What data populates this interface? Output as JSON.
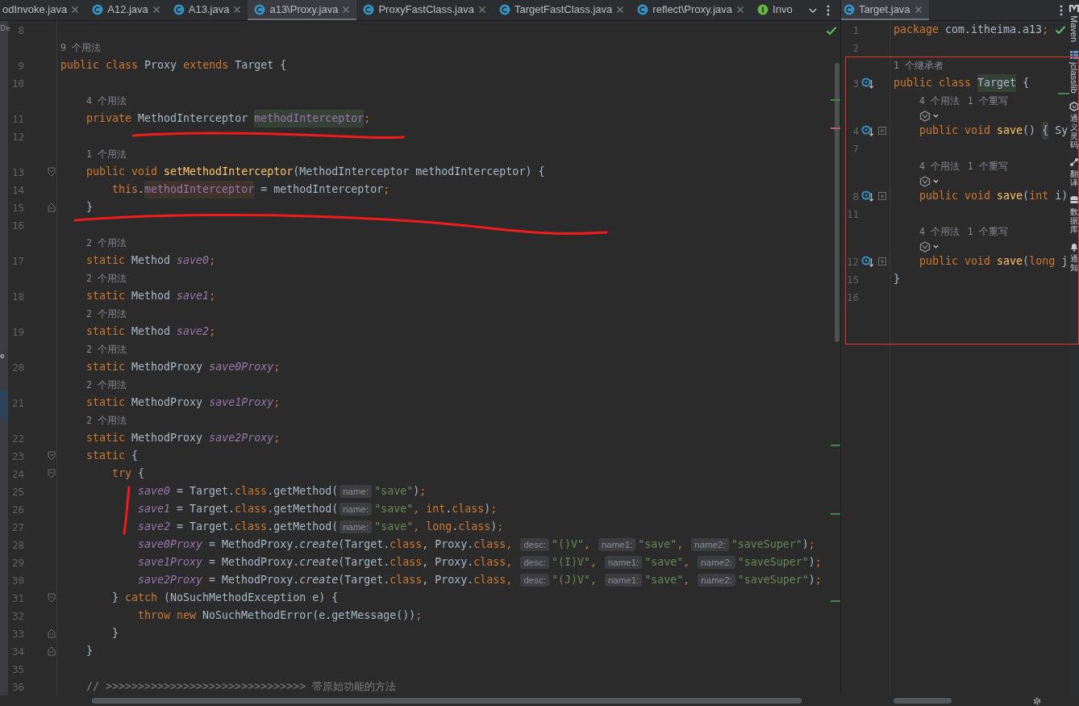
{
  "left_editor": {
    "tabs": [
      {
        "label": "odInvoke.java",
        "kind": "file",
        "closable": true,
        "selected": false
      },
      {
        "label": "A12.java",
        "kind": "class",
        "closable": true,
        "selected": false
      },
      {
        "label": "A13.java",
        "kind": "class",
        "closable": true,
        "selected": false
      },
      {
        "label": "a13\\Proxy.java",
        "kind": "class",
        "closable": true,
        "selected": true
      },
      {
        "label": "ProxyFastClass.java",
        "kind": "class",
        "closable": true,
        "selected": false
      },
      {
        "label": "TargetFastClass.java",
        "kind": "class",
        "closable": true,
        "selected": false
      },
      {
        "label": "reflect\\Proxy.java",
        "kind": "class",
        "closable": true,
        "selected": false
      },
      {
        "label": "Invo",
        "kind": "interface",
        "closable": false,
        "selected": false
      }
    ],
    "lines": [
      {
        "kind": "code",
        "number": "8"
      },
      {
        "kind": "hint",
        "texts": [
          "9 个用法"
        ]
      },
      {
        "kind": "code",
        "number": "9",
        "tokens": [
          {
            "kind": "kw",
            "text": "public class "
          },
          {
            "kind": "plain",
            "text": "Proxy "
          },
          {
            "kind": "kw",
            "text": "extends "
          },
          {
            "kind": "plain",
            "text": "Target {"
          }
        ],
        "children": [
          {
            "kind": "code",
            "number": "10"
          },
          {
            "kind": "hint",
            "texts": [
              "4 个用法"
            ]
          },
          {
            "kind": "code",
            "number": "11",
            "tokens": [
              {
                "kind": "kw",
                "text": "private "
              },
              {
                "kind": "plain",
                "text": "MethodInterceptor "
              },
              {
                "kind": "field",
                "text": "methodInterceptor",
                "write_access": true
              },
              {
                "kind": "kw",
                "text": ";"
              }
            ]
          },
          {
            "kind": "code",
            "number": "12"
          },
          {
            "kind": "hint",
            "texts": [
              "1 个用法"
            ]
          },
          {
            "kind": "code",
            "number": "13",
            "fold_open": true,
            "tokens": [
              {
                "kind": "kw",
                "text": "public void "
              },
              {
                "kind": "decl",
                "text": "setMethodInterceptor"
              },
              {
                "kind": "plain",
                "text": "(MethodInterceptor methodInterceptor) {"
              }
            ],
            "children": [
              {
                "kind": "code",
                "number": "14",
                "tokens": [
                  {
                    "kind": "kw",
                    "text": "this"
                  },
                  {
                    "kind": "plain",
                    "text": "."
                  },
                  {
                    "kind": "field",
                    "text": "methodInterceptor",
                    "read_access": true
                  },
                  {
                    "kind": "plain",
                    "text": " = methodInterceptor"
                  },
                  {
                    "kind": "kw",
                    "text": ";"
                  }
                ]
              }
            ]
          },
          {
            "kind": "code",
            "number": "15",
            "fold_close": true,
            "tokens": [
              {
                "kind": "plain",
                "text": "}"
              }
            ]
          },
          {
            "kind": "code",
            "number": "16"
          },
          {
            "kind": "hint",
            "texts": [
              "2 个用法"
            ]
          },
          {
            "kind": "code",
            "number": "17",
            "tokens": [
              {
                "kind": "kw",
                "text": "static "
              },
              {
                "kind": "plain",
                "text": "Method "
              },
              {
                "kind": "sfield",
                "text": "save0"
              },
              {
                "kind": "kw",
                "text": ";"
              }
            ]
          },
          {
            "kind": "hint",
            "texts": [
              "2 个用法"
            ]
          },
          {
            "kind": "code",
            "number": "18",
            "tokens": [
              {
                "kind": "kw",
                "text": "static "
              },
              {
                "kind": "plain",
                "text": "Method "
              },
              {
                "kind": "sfield",
                "text": "save1"
              },
              {
                "kind": "kw",
                "text": ";"
              }
            ]
          },
          {
            "kind": "hint",
            "texts": [
              "2 个用法"
            ]
          },
          {
            "kind": "code",
            "number": "19",
            "tokens": [
              {
                "kind": "kw",
                "text": "static "
              },
              {
                "kind": "plain",
                "text": "Method "
              },
              {
                "kind": "sfield",
                "text": "save2"
              },
              {
                "kind": "kw",
                "text": ";"
              }
            ]
          },
          {
            "kind": "hint",
            "texts": [
              "2 个用法"
            ]
          },
          {
            "kind": "code",
            "number": "20",
            "tokens": [
              {
                "kind": "kw",
                "text": "static "
              },
              {
                "kind": "plain",
                "text": "MethodProxy "
              },
              {
                "kind": "sfield",
                "text": "save0Proxy"
              },
              {
                "kind": "kw",
                "text": ";"
              }
            ]
          },
          {
            "kind": "hint",
            "texts": [
              "2 个用法"
            ]
          },
          {
            "kind": "code",
            "number": "21",
            "tokens": [
              {
                "kind": "kw",
                "text": "static "
              },
              {
                "kind": "plain",
                "text": "MethodProxy "
              },
              {
                "kind": "sfield",
                "text": "save1Proxy"
              },
              {
                "kind": "kw",
                "text": ";"
              }
            ]
          },
          {
            "kind": "hint",
            "texts": [
              "2 个用法"
            ]
          },
          {
            "kind": "code",
            "number": "22",
            "tokens": [
              {
                "kind": "kw",
                "text": "static "
              },
              {
                "kind": "plain",
                "text": "MethodProxy "
              },
              {
                "kind": "sfield",
                "text": "save2Proxy"
              },
              {
                "kind": "kw",
                "text": ";"
              }
            ]
          },
          {
            "kind": "code",
            "number": "23",
            "fold_open": true,
            "tokens": [
              {
                "kind": "kw",
                "text": "static "
              },
              {
                "kind": "plain",
                "text": "{"
              }
            ],
            "children": [
              {
                "kind": "code",
                "number": "24",
                "fold_open": true,
                "tokens": [
                  {
                    "kind": "kw",
                    "text": "try "
                  },
                  {
                    "kind": "plain",
                    "text": "{"
                  }
                ],
                "children": [
                  {
                    "kind": "code",
                    "number": "25",
                    "tokens": [
                      {
                        "kind": "sfield",
                        "text": "save0"
                      },
                      {
                        "kind": "plain",
                        "text": " = Target."
                      },
                      {
                        "kind": "kw",
                        "text": "class"
                      },
                      {
                        "kind": "plain",
                        "text": ".getMethod("
                      },
                      {
                        "kind": "hint",
                        "text": "name:"
                      },
                      {
                        "kind": "str",
                        "text": "\"save\""
                      },
                      {
                        "kind": "plain",
                        "text": ")"
                      },
                      {
                        "kind": "kw",
                        "text": ";"
                      }
                    ]
                  },
                  {
                    "kind": "code",
                    "number": "26",
                    "tokens": [
                      {
                        "kind": "sfield",
                        "text": "save1"
                      },
                      {
                        "kind": "plain",
                        "text": " = Target."
                      },
                      {
                        "kind": "kw",
                        "text": "class"
                      },
                      {
                        "kind": "plain",
                        "text": ".getMethod("
                      },
                      {
                        "kind": "hint",
                        "text": "name:"
                      },
                      {
                        "kind": "str",
                        "text": "\"save\""
                      },
                      {
                        "kind": "kw",
                        "text": ", int"
                      },
                      {
                        "kind": "plain",
                        "text": "."
                      },
                      {
                        "kind": "kw",
                        "text": "class"
                      },
                      {
                        "kind": "plain",
                        "text": ")"
                      },
                      {
                        "kind": "kw",
                        "text": ";"
                      }
                    ]
                  },
                  {
                    "kind": "code",
                    "number": "27",
                    "tokens": [
                      {
                        "kind": "sfield",
                        "text": "save2"
                      },
                      {
                        "kind": "plain",
                        "text": " = Target."
                      },
                      {
                        "kind": "kw",
                        "text": "class"
                      },
                      {
                        "kind": "plain",
                        "text": ".getMethod("
                      },
                      {
                        "kind": "hint",
                        "text": "name:"
                      },
                      {
                        "kind": "str",
                        "text": "\"save\""
                      },
                      {
                        "kind": "kw",
                        "text": ", long"
                      },
                      {
                        "kind": "plain",
                        "text": "."
                      },
                      {
                        "kind": "kw",
                        "text": "class"
                      },
                      {
                        "kind": "plain",
                        "text": ")"
                      },
                      {
                        "kind": "kw",
                        "text": ";"
                      }
                    ]
                  },
                  {
                    "kind": "code",
                    "number": "28",
                    "tokens": [
                      {
                        "kind": "sfield",
                        "text": "save0Proxy"
                      },
                      {
                        "kind": "plain",
                        "text": " = MethodProxy."
                      },
                      {
                        "kind": "smethod",
                        "text": "create"
                      },
                      {
                        "kind": "plain",
                        "text": "(Target."
                      },
                      {
                        "kind": "kw",
                        "text": "class"
                      },
                      {
                        "kind": "plain",
                        "text": ", Proxy."
                      },
                      {
                        "kind": "kw",
                        "text": "class, "
                      },
                      {
                        "kind": "hint",
                        "text": "desc:"
                      },
                      {
                        "kind": "str",
                        "text": "\"()V\""
                      },
                      {
                        "kind": "kw",
                        "text": ", "
                      },
                      {
                        "kind": "hint",
                        "text": "name1:"
                      },
                      {
                        "kind": "str",
                        "text": "\"save\""
                      },
                      {
                        "kind": "kw",
                        "text": ", "
                      },
                      {
                        "kind": "hint",
                        "text": "name2:"
                      },
                      {
                        "kind": "str",
                        "text": "\"saveSuper\""
                      },
                      {
                        "kind": "plain",
                        "text": ")"
                      },
                      {
                        "kind": "kw",
                        "text": ";"
                      }
                    ]
                  },
                  {
                    "kind": "code",
                    "number": "29",
                    "tokens": [
                      {
                        "kind": "sfield",
                        "text": "save1Proxy"
                      },
                      {
                        "kind": "plain",
                        "text": " = MethodProxy."
                      },
                      {
                        "kind": "smethod",
                        "text": "create"
                      },
                      {
                        "kind": "plain",
                        "text": "(Target."
                      },
                      {
                        "kind": "kw",
                        "text": "class"
                      },
                      {
                        "kind": "plain",
                        "text": ", Proxy."
                      },
                      {
                        "kind": "kw",
                        "text": "class, "
                      },
                      {
                        "kind": "hint",
                        "text": "desc:"
                      },
                      {
                        "kind": "str",
                        "text": "\"(I)V\""
                      },
                      {
                        "kind": "kw",
                        "text": ", "
                      },
                      {
                        "kind": "hint",
                        "text": "name1:"
                      },
                      {
                        "kind": "str",
                        "text": "\"save\""
                      },
                      {
                        "kind": "kw",
                        "text": ", "
                      },
                      {
                        "kind": "hint",
                        "text": "name2:"
                      },
                      {
                        "kind": "str",
                        "text": "\"saveSuper\""
                      },
                      {
                        "kind": "plain",
                        "text": ")"
                      },
                      {
                        "kind": "kw",
                        "text": ";"
                      }
                    ]
                  },
                  {
                    "kind": "code",
                    "number": "30",
                    "tokens": [
                      {
                        "kind": "sfield",
                        "text": "save2Proxy"
                      },
                      {
                        "kind": "plain",
                        "text": " = MethodProxy."
                      },
                      {
                        "kind": "smethod",
                        "text": "create"
                      },
                      {
                        "kind": "plain",
                        "text": "(Target."
                      },
                      {
                        "kind": "kw",
                        "text": "class"
                      },
                      {
                        "kind": "plain",
                        "text": ", Proxy."
                      },
                      {
                        "kind": "kw",
                        "text": "class, "
                      },
                      {
                        "kind": "hint",
                        "text": "desc:"
                      },
                      {
                        "kind": "str",
                        "text": "\"(J)V\""
                      },
                      {
                        "kind": "kw",
                        "text": ", "
                      },
                      {
                        "kind": "hint",
                        "text": "name1:"
                      },
                      {
                        "kind": "str",
                        "text": "\"save\""
                      },
                      {
                        "kind": "kw",
                        "text": ", "
                      },
                      {
                        "kind": "hint",
                        "text": "name2:"
                      },
                      {
                        "kind": "str",
                        "text": "\"saveSuper\""
                      },
                      {
                        "kind": "plain",
                        "text": ")"
                      },
                      {
                        "kind": "kw",
                        "text": ";"
                      }
                    ]
                  }
                ]
              },
              {
                "kind": "code",
                "number": "31",
                "fold_open": true,
                "tokens": [
                  {
                    "kind": "plain",
                    "text": "} "
                  },
                  {
                    "kind": "kw",
                    "text": "catch "
                  },
                  {
                    "kind": "plain",
                    "text": "(NoSuchMethodException e) {"
                  }
                ],
                "children": [
                  {
                    "kind": "code",
                    "number": "32",
                    "tokens": [
                      {
                        "kind": "kw",
                        "text": "throw new "
                      },
                      {
                        "kind": "plain",
                        "text": "NoSuchMethodError(e.getMessage())"
                      },
                      {
                        "kind": "kw",
                        "text": ";"
                      }
                    ]
                  }
                ]
              },
              {
                "kind": "code",
                "number": "33",
                "fold_close": true,
                "tokens": [
                  {
                    "kind": "plain",
                    "text": "}"
                  }
                ]
              }
            ]
          },
          {
            "kind": "code",
            "number": "34",
            "fold_close": true,
            "tokens": [
              {
                "kind": "plain",
                "text": "}"
              }
            ]
          },
          {
            "kind": "code",
            "number": "35"
          },
          {
            "kind": "code",
            "number": "36",
            "tokens": [
              {
                "kind": "comment",
                "text": "// >>>>>>>>>>>>>>>>>>>>>>>>>>>>>>> 带原始功能的方法"
              }
            ]
          }
        ]
      }
    ]
  },
  "right_editor": {
    "tabs": [
      {
        "label": "Target.java",
        "kind": "class",
        "closable": true,
        "selected": true
      }
    ],
    "lines": [
      {
        "kind": "code",
        "number": "1",
        "tokens": [
          {
            "kind": "kw",
            "text": "package "
          },
          {
            "kind": "plain",
            "text": "com.itheima.a13"
          },
          {
            "kind": "kw",
            "text": ";"
          }
        ]
      },
      {
        "kind": "code",
        "number": "2"
      },
      {
        "kind": "hint",
        "texts": [
          "1 个继承者"
        ]
      },
      {
        "kind": "code",
        "number": "3",
        "overrides": true,
        "tokens": [
          {
            "kind": "kw",
            "text": "public class "
          },
          {
            "kind": "plain",
            "text": "Target",
            "write_access": true
          },
          {
            "kind": "plain",
            "text": " {"
          }
        ],
        "children": [
          {
            "kind": "hint",
            "texts": [
              "4 个用法",
              "1 个重写"
            ]
          },
          {
            "kind": "assist"
          },
          {
            "kind": "code",
            "number": "4",
            "overrides": true,
            "collapsed": true,
            "tokens": [
              {
                "kind": "kw",
                "text": "public void "
              },
              {
                "kind": "decl",
                "text": "save"
              },
              {
                "kind": "plain",
                "text": "() "
              },
              {
                "kind": "plain",
                "text": "{",
                "folded": true
              },
              {
                "kind": "plain",
                "text": " Sy"
              }
            ]
          },
          {
            "kind": "code",
            "number": "7"
          },
          {
            "kind": "hint",
            "texts": [
              "4 个用法",
              "1 个重写"
            ]
          },
          {
            "kind": "assist"
          },
          {
            "kind": "code",
            "number": "8",
            "overrides": true,
            "collapsed": true,
            "tokens": [
              {
                "kind": "kw",
                "text": "public void "
              },
              {
                "kind": "decl",
                "text": "save"
              },
              {
                "kind": "plain",
                "text": "("
              },
              {
                "kind": "kw",
                "text": "int "
              },
              {
                "kind": "plain",
                "text": "i)"
              }
            ]
          },
          {
            "kind": "code",
            "number": "11"
          },
          {
            "kind": "hint",
            "texts": [
              "4 个用法",
              "1 个重写"
            ]
          },
          {
            "kind": "assist"
          },
          {
            "kind": "code",
            "number": "12",
            "overrides": true,
            "collapsed": true,
            "tokens": [
              {
                "kind": "kw",
                "text": "public void "
              },
              {
                "kind": "decl",
                "text": "save"
              },
              {
                "kind": "plain",
                "text": "("
              },
              {
                "kind": "kw",
                "text": "long "
              },
              {
                "kind": "plain",
                "text": "j"
              }
            ]
          }
        ]
      },
      {
        "kind": "code",
        "number": "15",
        "tokens": [
          {
            "kind": "plain",
            "text": "}"
          }
        ]
      },
      {
        "kind": "code",
        "number": "16"
      }
    ]
  },
  "tool_strip": [
    {
      "label": "Maven",
      "kind": "latin"
    },
    {
      "label": "jclasslib",
      "kind": "latin"
    },
    {
      "label": "通义灵码",
      "kind": "cjk"
    },
    {
      "label": "翻译",
      "kind": "cjk"
    },
    {
      "label": "数据库",
      "kind": "cjk"
    },
    {
      "label": "通知",
      "kind": "cjk"
    }
  ],
  "side_fragments": [
    "De",
    "e"
  ],
  "annotations": [
    {
      "kind": "stroke"
    },
    {
      "kind": "stroke"
    },
    {
      "kind": "stroke"
    },
    {
      "kind": "frame"
    }
  ]
}
